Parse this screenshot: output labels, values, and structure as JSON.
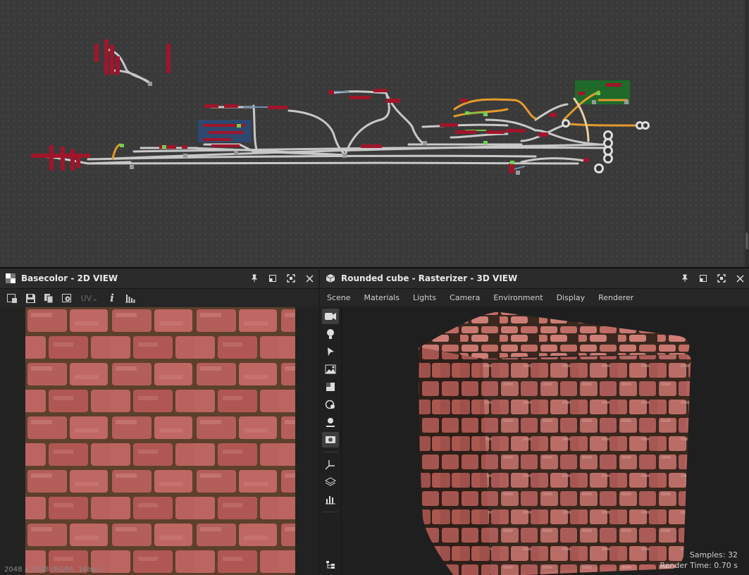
{
  "panels": {
    "view2d": {
      "title": "Basecolor - 2D VIEW",
      "uv_label": "UV",
      "status": "2048 x 2048 (RGBA, 16bpc)"
    },
    "view3d": {
      "title": "Rounded cube - Rasterizer - 3D VIEW",
      "menu": [
        "Scene",
        "Materials",
        "Lights",
        "Camera",
        "Environment",
        "Display",
        "Renderer"
      ],
      "samples": "Samples: 32",
      "render_time": "Render Time: 0.70 s"
    }
  },
  "icons": {
    "window_controls": [
      "pin-icon",
      "restore-icon",
      "maximize-icon",
      "close-icon"
    ],
    "toolbar2d": [
      "export-icon",
      "save-icon",
      "copy-icon",
      "view-settings-icon",
      "info-icon",
      "histogram-icon"
    ],
    "sidebar3d": [
      "camera-icon",
      "light-icon",
      "cursor-icon",
      "environment-icon",
      "material-icon",
      "shading-icon",
      "lights-icon",
      "renderer-icon",
      "axis-icon",
      "layers-icon",
      "stats-icon",
      "hierarchy-icon"
    ]
  },
  "colors": {
    "brick": "#b25a57",
    "mortar": "#5a3f2b",
    "node_red": "#a0152a",
    "wire_orange": "#e59a2c",
    "frame_green": "#1f6a2a",
    "frame_blue": "#2c4c77"
  }
}
